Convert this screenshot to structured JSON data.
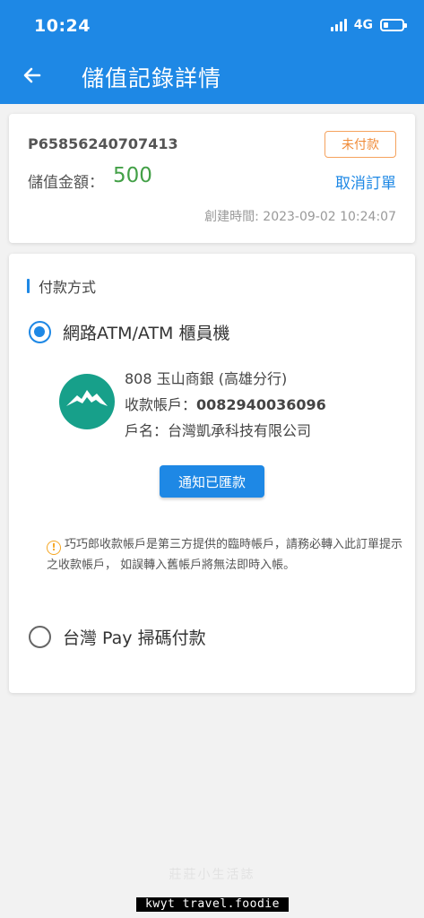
{
  "status_bar": {
    "time": "10:24",
    "network": "4G"
  },
  "header": {
    "title": "儲值記錄詳情",
    "back_icon": "arrow-left-icon"
  },
  "order": {
    "id": "P65856240707413",
    "status": "未付款",
    "amount_label": "儲值金額：",
    "amount": "500",
    "cancel_label": "取消訂單",
    "created_at": "創建時間: 2023-09-02 10:24:07"
  },
  "payment": {
    "section_title": "付款方式",
    "options": [
      {
        "label": "網路ATM/ATM 櫃員機",
        "selected": true
      },
      {
        "label": "台灣 Pay 掃碼付款",
        "selected": false
      }
    ],
    "bank": {
      "name": "808 玉山商銀 (高雄分行)",
      "account_label": "收款帳戶：",
      "account_number": "0082940036096",
      "holder_label": "戶名：",
      "holder": "台灣凱承科技有限公司",
      "logo_icon": "esun-bank-logo-icon"
    },
    "notify_button": "通知已匯款",
    "notice": "巧巧郎收款帳戶是第三方提供的臨時帳戶，請務必轉入此訂單提示之收款帳戶， 如誤轉入舊帳戶將無法即時入帳。"
  },
  "watermarks": {
    "faded": "莊莊小生活誌",
    "black": "kwyt travel.foodie"
  },
  "colors": {
    "primary": "#1e88e5",
    "amount": "#43a047",
    "status": "#f08c3a",
    "bank_logo": "#17a08a"
  }
}
